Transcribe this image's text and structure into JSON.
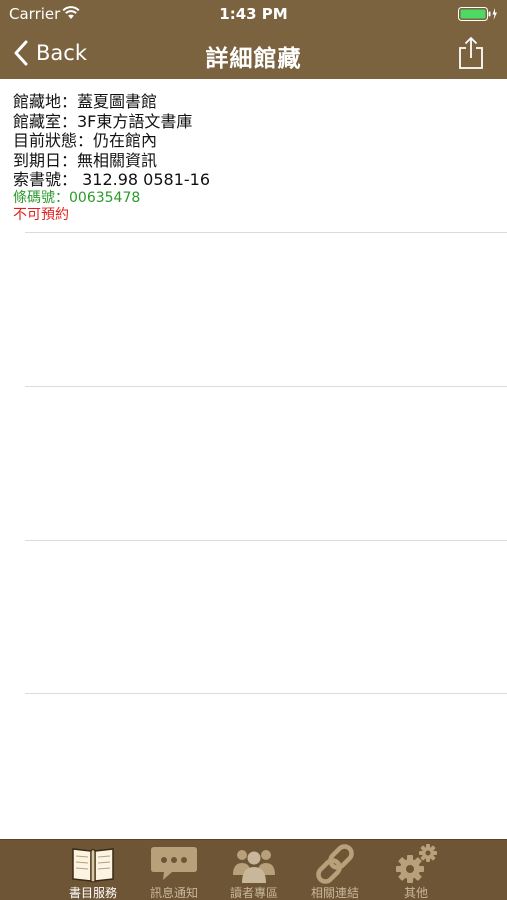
{
  "status_bar": {
    "carrier": "Carrier",
    "time": "1:43 PM",
    "wifi_icon": "wifi-icon",
    "battery_icon": "battery-icon"
  },
  "nav": {
    "back_label": "Back",
    "title": "詳細館藏",
    "share_icon": "share-icon"
  },
  "holding": {
    "library": "館藏地：蓋夏圖書館",
    "room": "館藏室：3F東方語文書庫",
    "status": "目前狀態：仍在館內",
    "due": "到期日：無相關資訊",
    "call_number": "索書號： 312.98 0581-16",
    "barcode": "條碼號：00635478",
    "reservation": "不可預約"
  },
  "tabs": [
    {
      "label": "書目服務",
      "icon": "book-icon",
      "active": true
    },
    {
      "label": "訊息通知",
      "icon": "chat-bubble-icon",
      "active": false
    },
    {
      "label": "讀者專區",
      "icon": "users-icon",
      "active": false
    },
    {
      "label": "相關連結",
      "icon": "link-icon",
      "active": false
    },
    {
      "label": "其他",
      "icon": "gears-icon",
      "active": false
    }
  ],
  "colors": {
    "header_bg": "#7b6340",
    "tab_bar_bg": "#6e5536",
    "barcode_green": "#2a9a2a",
    "reserve_red": "#e0221e",
    "tab_inactive": "#c9b79b"
  }
}
